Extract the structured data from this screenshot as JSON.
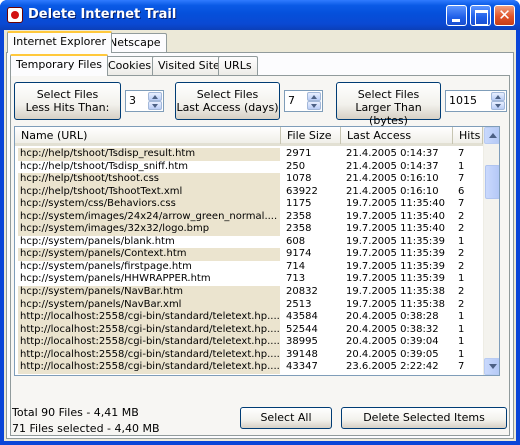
{
  "window": {
    "title": "Delete Internet Trail"
  },
  "outer_tabs": [
    "Internet Explorer",
    "Netscape"
  ],
  "inner_tabs": [
    "Temporary Files",
    "Cookies",
    "Visited Sites",
    "URLs"
  ],
  "filters": {
    "hits": {
      "line1": "Select Files",
      "line2": "Less Hits Than:",
      "value": "3"
    },
    "access": {
      "line1": "Select Files",
      "line2": "Last Access (days)",
      "value": "7"
    },
    "size": {
      "line1": "Select Files",
      "line2": "Larger Than (bytes)",
      "value": "1015"
    }
  },
  "columns": [
    "Name (URL)",
    "File Size",
    "Last Access",
    "Hits"
  ],
  "rows": [
    {
      "name": "hcp://help/tshoot/Tsdisp_result.htm",
      "size": "2971",
      "access": "21.4.2005 0:14:37",
      "hits": "7",
      "selected": true
    },
    {
      "name": "hcp://help/tshoot/Tsdisp_sniff.htm",
      "size": "250",
      "access": "21.4.2005 0:14:37",
      "hits": "1",
      "selected": false
    },
    {
      "name": "hcp://help/tshoot/tshoot.css",
      "size": "1078",
      "access": "21.4.2005 0:16:10",
      "hits": "7",
      "selected": true
    },
    {
      "name": "hcp://help/tshoot/TshootText.xml",
      "size": "63922",
      "access": "21.4.2005 0:16:10",
      "hits": "6",
      "selected": true
    },
    {
      "name": "hcp://system/css/Behaviors.css",
      "size": "1175",
      "access": "19.7.2005 11:35:40",
      "hits": "7",
      "selected": true
    },
    {
      "name": "hcp://system/images/24x24/arrow_green_normal....",
      "size": "2358",
      "access": "19.7.2005 11:35:40",
      "hits": "2",
      "selected": true
    },
    {
      "name": "hcp://system/images/32x32/logo.bmp",
      "size": "2358",
      "access": "19.7.2005 11:35:40",
      "hits": "2",
      "selected": true
    },
    {
      "name": "hcp://system/panels/blank.htm",
      "size": "608",
      "access": "19.7.2005 11:35:39",
      "hits": "1",
      "selected": false
    },
    {
      "name": "hcp://system/panels/Context.htm",
      "size": "9174",
      "access": "19.7.2005 11:35:39",
      "hits": "2",
      "selected": true
    },
    {
      "name": "hcp://system/panels/firstpage.htm",
      "size": "714",
      "access": "19.7.2005 11:35:39",
      "hits": "2",
      "selected": false
    },
    {
      "name": "hcp://system/panels/HHWRAPPER.htm",
      "size": "713",
      "access": "19.7.2005 11:35:39",
      "hits": "1",
      "selected": false
    },
    {
      "name": "hcp://system/panels/NavBar.htm",
      "size": "20832",
      "access": "19.7.2005 11:35:38",
      "hits": "2",
      "selected": true
    },
    {
      "name": "hcp://system/panels/NavBar.xml",
      "size": "2513",
      "access": "19.7.2005 11:35:38",
      "hits": "2",
      "selected": true
    },
    {
      "name": "http://localhost:2558/cgi-bin/standard/teletext.hp....",
      "size": "43584",
      "access": "20.4.2005 0:38:28",
      "hits": "1",
      "selected": true
    },
    {
      "name": "http://localhost:2558/cgi-bin/standard/teletext.hp....",
      "size": "52544",
      "access": "20.4.2005 0:38:32",
      "hits": "1",
      "selected": true
    },
    {
      "name": "http://localhost:2558/cgi-bin/standard/teletext.hp....",
      "size": "38995",
      "access": "20.4.2005 0:39:04",
      "hits": "1",
      "selected": true
    },
    {
      "name": "http://localhost:2558/cgi-bin/standard/teletext.hp....",
      "size": "39148",
      "access": "20.4.2005 0:39:05",
      "hits": "1",
      "selected": true
    },
    {
      "name": "http://localhost:2558/cgi-bin/standard/teletext.hp....",
      "size": "43347",
      "access": "23.6.2005 2:22:42",
      "hits": "7",
      "selected": true
    }
  ],
  "status": {
    "total": "Total 90 Files - 4,41 MB",
    "selected": "71 Files selected - 4,40 MB"
  },
  "buttons": {
    "select_all": "Select All",
    "delete": "Delete Selected Items"
  }
}
